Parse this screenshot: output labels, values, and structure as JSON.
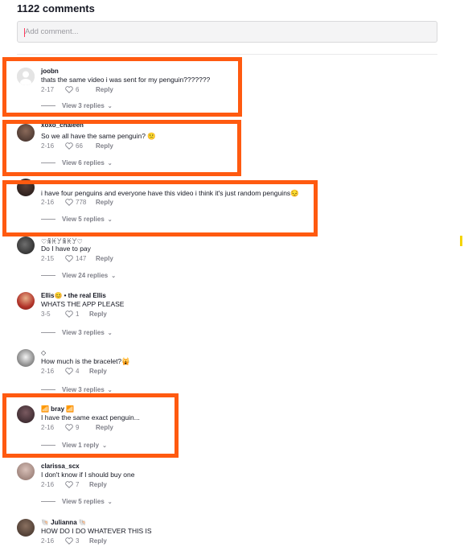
{
  "header": {
    "title": "1122 comments"
  },
  "add_comment": {
    "placeholder": "Add comment..."
  },
  "comments": [
    {
      "user": "joobn",
      "text": "thats the same video i was sent for my penguin???????",
      "date": "2-17",
      "likes": "6",
      "reply": "Reply",
      "view_replies": "View 3 replies"
    },
    {
      "user": "xoxo_chaleen",
      "text": "So we all have the same penguin? 🙁",
      "date": "2-16",
      "likes": "66",
      "reply": "Reply",
      "view_replies": "View 6 replies"
    },
    {
      "user": "",
      "text": "i have four penguins and everyone have this video i think it's just random penguins😔",
      "date": "2-16",
      "likes": "778",
      "reply": "Reply",
      "view_replies": "View 5 replies"
    },
    {
      "user": "♡ꆜꀘꌦꆜꀘꌦ♡",
      "text": "Do I have to pay",
      "date": "2-15",
      "likes": "147",
      "reply": "Reply",
      "view_replies": "View 24 replies"
    },
    {
      "user": "Ellis😊 • the real Ellis",
      "text": "WHATS THE APP PLEASE",
      "date": "3-5",
      "likes": "1",
      "reply": "Reply",
      "view_replies": "View 3 replies"
    },
    {
      "user": "◇",
      "text": "How much is the bracelet?🙀",
      "date": "2-16",
      "likes": "4",
      "reply": "Reply",
      "view_replies": "View 3 replies"
    },
    {
      "user": "📶 bray 📶",
      "text": "I have the same exact penguin...",
      "date": "2-16",
      "likes": "9",
      "reply": "Reply",
      "view_replies": "View 1 reply"
    },
    {
      "user": "clarissa_scx",
      "text": "I don't know if I should buy one",
      "date": "2-16",
      "likes": "7",
      "reply": "Reply",
      "view_replies": "View 5 replies"
    },
    {
      "user": "🐚 Julianna 🐚",
      "text": "HOW DO I DO WHATEVER THIS IS",
      "date": "2-16",
      "likes": "3",
      "reply": "Reply",
      "view_replies": ""
    }
  ],
  "colors": {
    "highlight": "#ff5a10",
    "muted": "#80818a",
    "text": "#161823"
  }
}
